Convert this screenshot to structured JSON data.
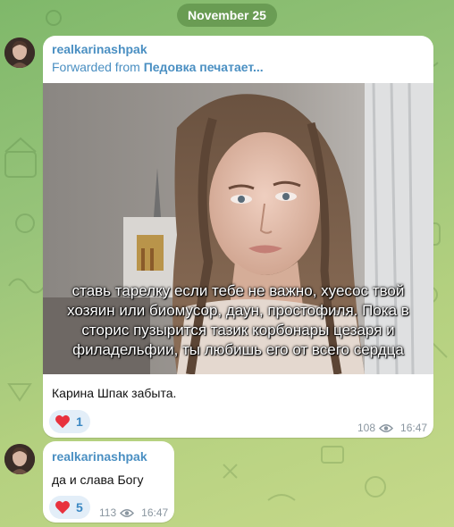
{
  "date_pill": "November 25",
  "messages": [
    {
      "sender": "realkarinashpak",
      "forwarded_prefix": "Forwarded from",
      "forwarded_source": "Педовка печатает...",
      "image_caption": "ставь тарелку если тебе не важно, хуесос твой хозяин или биомусор, даун, простофиля. Пока в сторис пузырится тазик корбонары цезаря и филадельфии, ты любишь его от всего сердца",
      "text": "Карина Шпак забыта.",
      "reaction": {
        "emoji": "heart-icon",
        "count": "1"
      },
      "views": "108",
      "time": "16:47"
    },
    {
      "sender": "realkarinashpak",
      "text": "да и слава Богу",
      "reaction": {
        "emoji": "heart-icon",
        "count": "5"
      },
      "views": "113",
      "time": "16:47"
    }
  ],
  "colors": {
    "accent": "#4a8fc2",
    "reaction_bg": "#e3eef8",
    "heart": "#e8323e",
    "date_pill_bg": "#5b8a45"
  }
}
